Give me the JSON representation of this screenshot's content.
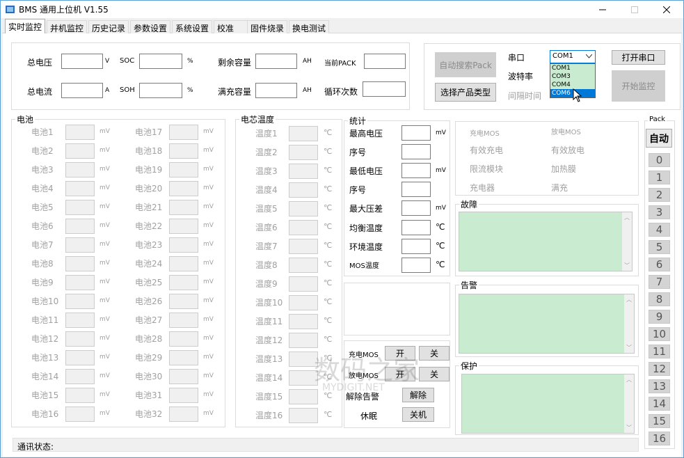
{
  "window": {
    "title": "BMS 通用上位机 V1.55",
    "minimize_icon": "minimize-icon",
    "maximize_icon": "maximize-icon",
    "close_icon": "close-icon"
  },
  "tabs": [
    "实时监控",
    "并机监控",
    "历史记录",
    "参数设置",
    "系统设置",
    "校准",
    "固件烧录",
    "换电测试"
  ],
  "summary": {
    "total_voltage": {
      "label": "总电压",
      "unit": "V",
      "value": ""
    },
    "soc": {
      "label": "SOC",
      "unit": "%",
      "value": ""
    },
    "remaining_capacity": {
      "label": "剩余容量",
      "unit": "AH",
      "value": ""
    },
    "current_pack": {
      "label": "当前PACK",
      "value": ""
    },
    "total_current": {
      "label": "总电流",
      "unit": "A",
      "value": ""
    },
    "soh": {
      "label": "SOH",
      "unit": "%",
      "value": ""
    },
    "full_capacity": {
      "label": "满充容量",
      "unit": "AH",
      "value": ""
    },
    "cycle_count": {
      "label": "循环次数",
      "value": ""
    }
  },
  "connection": {
    "auto_search": "自动搜索Pack",
    "select_product": "选择产品类型",
    "port_label": "串口",
    "baud_label": "波特率",
    "interval_label": "间隔时间",
    "selected_port": "COM1",
    "port_options": [
      "COM1",
      "COM3",
      "COM4",
      "COM6"
    ],
    "highlighted_option": "COM6",
    "open_port": "打开串口",
    "start_monitor": "开始监控"
  },
  "cells": {
    "title": "电池",
    "unit": "mV",
    "left": [
      "电池1",
      "电池2",
      "电池3",
      "电池4",
      "电池5",
      "电池6",
      "电池7",
      "电池8",
      "电池9",
      "电池10",
      "电池11",
      "电池12",
      "电池13",
      "电池14",
      "电池15",
      "电池16"
    ],
    "right": [
      "电池17",
      "电池18",
      "电池19",
      "电池20",
      "电池21",
      "电池22",
      "电池23",
      "电池24",
      "电池25",
      "电池26",
      "电池27",
      "电池28",
      "电池29",
      "电池30",
      "电池31",
      "电池32"
    ]
  },
  "temps": {
    "title": "电芯温度",
    "unit": "℃",
    "items": [
      "温度1",
      "温度2",
      "温度3",
      "温度4",
      "温度5",
      "温度6",
      "温度7",
      "温度8",
      "温度9",
      "温度10",
      "温度11",
      "温度12",
      "温度13",
      "温度14",
      "温度15",
      "温度16"
    ]
  },
  "stats": {
    "title": "统计",
    "rows": [
      {
        "label": "最高电压",
        "unit": "mV"
      },
      {
        "label": "序号",
        "unit": ""
      },
      {
        "label": "最低电压",
        "unit": "mV"
      },
      {
        "label": "序号",
        "unit": ""
      },
      {
        "label": "最大压差",
        "unit": "mV"
      },
      {
        "label": "均衡温度",
        "unit": "℃"
      },
      {
        "label": "环境温度",
        "unit": "℃"
      },
      {
        "label": "MOS温度",
        "unit": "℃"
      }
    ]
  },
  "controls": {
    "charge_mos": "充电MOS",
    "discharge_mos": "放电MOS",
    "on": "开",
    "off": "关",
    "clear_alarm": "解除告警",
    "clear": "解除",
    "sleep": "休眠",
    "shutdown": "关机"
  },
  "status_flags": {
    "charge_mos": "充电MOS",
    "discharge_mos": "放电MOS",
    "effective_charge": "有效充电",
    "effective_discharge": "有效放电",
    "current_limit": "限流模块",
    "heating_film": "加热膜",
    "charger": "充电器",
    "full": "满充"
  },
  "panels": {
    "fault": "故障",
    "alarm": "告警",
    "protection": "保护"
  },
  "pack": {
    "title": "Pack",
    "auto": "自动",
    "numbers": [
      "0",
      "1",
      "2",
      "3",
      "4",
      "5",
      "6",
      "7",
      "8",
      "9",
      "10",
      "11",
      "12",
      "13",
      "14",
      "15",
      "16"
    ]
  },
  "statusbar": {
    "label": "通讯状态:"
  },
  "watermark": {
    "text_cn": "数码之家",
    "text_en": "MYDIGIT.NET"
  }
}
